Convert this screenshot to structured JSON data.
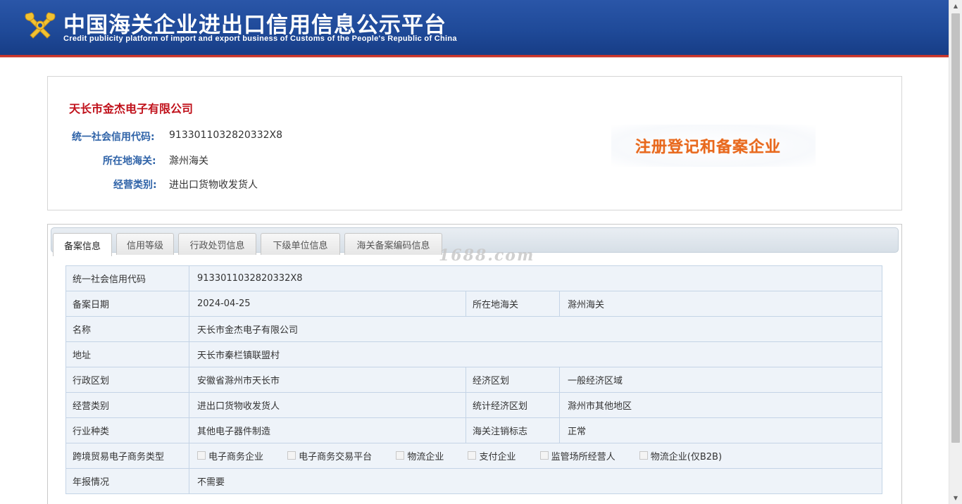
{
  "header": {
    "title": "中国海关企业进出口信用信息公示平台",
    "subtitle": "Credit publicity platform of import and export business of Customs of the People's Republic of China"
  },
  "summary": {
    "company_name": "天长市金杰电子有限公司",
    "rows": [
      {
        "label": "统一社会信用代码:",
        "value": "9133011032820332X8"
      },
      {
        "label": "所在地海关:",
        "value": "滁州海关"
      },
      {
        "label": "经营类别:",
        "value": "进出口货物收发货人"
      }
    ],
    "badge": "注册登记和备案企业"
  },
  "tabs": [
    {
      "label": "备案信息",
      "active": true
    },
    {
      "label": "信用等级",
      "active": false
    },
    {
      "label": "行政处罚信息",
      "active": false
    },
    {
      "label": "下级单位信息",
      "active": false
    },
    {
      "label": "海关备案编码信息",
      "active": false
    }
  ],
  "watermark": "1688.com",
  "detail": {
    "credit_code_label": "统一社会信用代码",
    "credit_code": "9133011032820332X8",
    "record_date_label": "备案日期",
    "record_date": "2024-04-25",
    "customs_label": "所在地海关",
    "customs": "滁州海关",
    "name_label": "名称",
    "name": "天长市金杰电子有限公司",
    "address_label": "地址",
    "address": "天长市秦栏镇联盟村",
    "admin_region_label": "行政区划",
    "admin_region": "安徽省滁州市天长市",
    "econ_region_label": "经济区划",
    "econ_region": "一般经济区域",
    "biz_type_label": "经营类别",
    "biz_type": "进出口货物收发货人",
    "stat_region_label": "统计经济区划",
    "stat_region": "滁州市其他地区",
    "industry_label": "行业种类",
    "industry": "其他电子器件制造",
    "cancel_label": "海关注销标志",
    "cancel": "正常",
    "ecommerce_label": "跨境贸易电子商务类型",
    "ecommerce_options": [
      "电子商务企业",
      "电子商务交易平台",
      "物流企业",
      "支付企业",
      "监管场所经营人",
      "物流企业(仅B2B)"
    ],
    "annual_report_label": "年报情况",
    "annual_report": "不需要"
  },
  "colors": {
    "header_bg": "#1f4a99",
    "header_border": "#c8342a",
    "company_name": "#c0101a",
    "label_blue": "#2f63a8",
    "badge_orange": "#e8691e",
    "table_bg": "#eef3f9",
    "table_border": "#c4d4e6"
  }
}
